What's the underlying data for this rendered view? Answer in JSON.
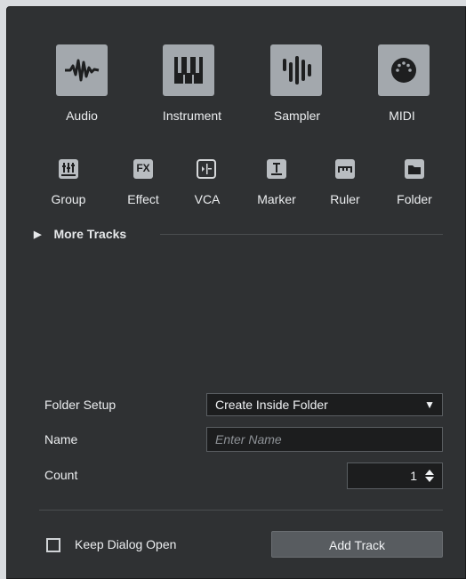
{
  "track_types": [
    {
      "label": "Audio",
      "icon": "waveform-icon"
    },
    {
      "label": "Instrument",
      "icon": "piano-keys-icon"
    },
    {
      "label": "Sampler",
      "icon": "sampler-bars-icon"
    },
    {
      "label": "MIDI",
      "icon": "midi-connector-icon"
    }
  ],
  "small_types": [
    {
      "label": "Group",
      "icon": "group-faders-icon"
    },
    {
      "label": "Effect",
      "icon": "fx-icon",
      "glyph": "FX"
    },
    {
      "label": "VCA",
      "icon": "vca-icon"
    },
    {
      "label": "Marker",
      "icon": "marker-icon"
    },
    {
      "label": "Ruler",
      "icon": "ruler-icon"
    },
    {
      "label": "Folder",
      "icon": "folder-icon"
    }
  ],
  "more_tracks": {
    "label": "More Tracks",
    "icon": "triangle-right-icon"
  },
  "form": {
    "folder_setup_label": "Folder Setup",
    "folder_setup_value": "Create Inside Folder",
    "name_label": "Name",
    "name_placeholder": "Enter Name",
    "count_label": "Count",
    "count_value": "1"
  },
  "footer": {
    "keep_open_label": "Keep Dialog Open",
    "add_track_label": "Add Track"
  },
  "colors": {
    "dialog_bg": "#2f3133",
    "button_bg": "#a3a8ad",
    "input_bg": "#1c1d1e"
  }
}
